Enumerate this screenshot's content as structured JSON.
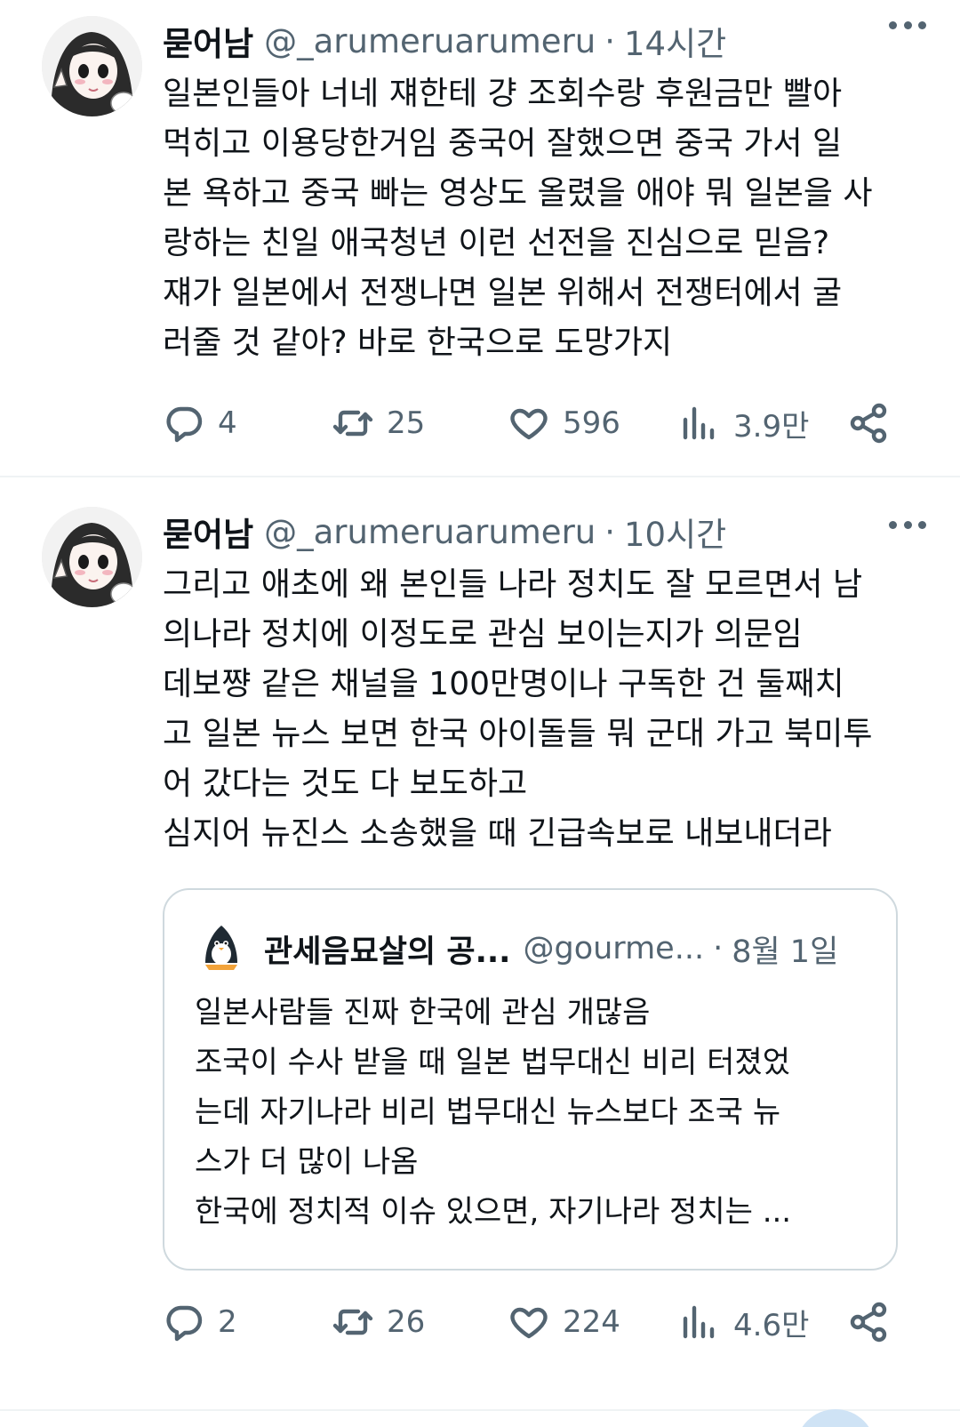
{
  "tweets": [
    {
      "author_name": "묻어남",
      "handle": "@_arumeruarumeru",
      "separator": "·",
      "time": "14시간",
      "text": "일본인들아 너네 쟤한테 걍 조회수랑 후원금만 빨아\n먹히고 이용당한거임 중국어 잘했으면 중국 가서 일\n본 욕하고 중국 빠는 영상도 올렸을 애야 뭐 일본을 사\n랑하는 친일 애국청년 이런 선전을 진심으로 믿음?\n쟤가 일본에서 전쟁나면 일본 위해서 전쟁터에서 굴\n러줄 것 같아? 바로 한국으로 도망가지",
      "replies": "4",
      "retweets": "25",
      "likes": "596",
      "views": "3.9만"
    },
    {
      "author_name": "묻어남",
      "handle": "@_arumeruarumeru",
      "separator": "·",
      "time": "10시간",
      "text": "그리고 애초에 왜 본인들 나라 정치도 잘 모르면서 남\n의나라 정치에 이정도로 관심 보이는지가 의문임\n데보쨩 같은 채널을 100만명이나 구독한 건 둘째치\n고 일본 뉴스 보면 한국 아이돌들 뭐 군대 가고 북미투\n어 갔다는 것도 다 보도하고\n심지어 뉴진스 소송했을 때 긴급속보로 내보내더라",
      "quote": {
        "author_name": "관세음묘살의 공...",
        "handle": "@gourme...",
        "separator": "·",
        "time": "8월 1일",
        "text": "일본사람들 진짜 한국에 관심 개많음\n조국이 수사 받을 때 일본 법무대신 비리 터졌었\n는데 자기나라 비리 법무대신 뉴스보다 조국 뉴\n스가 더 많이 나옴\n한국에 정치적 이슈 있으면, 자기나라 정치는 ..."
      },
      "replies": "2",
      "retweets": "26",
      "likes": "224",
      "views": "4.6만"
    }
  ],
  "icons": {
    "reply": "reply-icon",
    "retweet": "retweet-icon",
    "like": "heart-icon",
    "views": "views-icon",
    "share": "share-icon",
    "more": "more-icon"
  },
  "colors": {
    "text": "#0f1419",
    "secondary": "#536471",
    "border": "#cfd9de",
    "divider": "#eff3f4"
  }
}
